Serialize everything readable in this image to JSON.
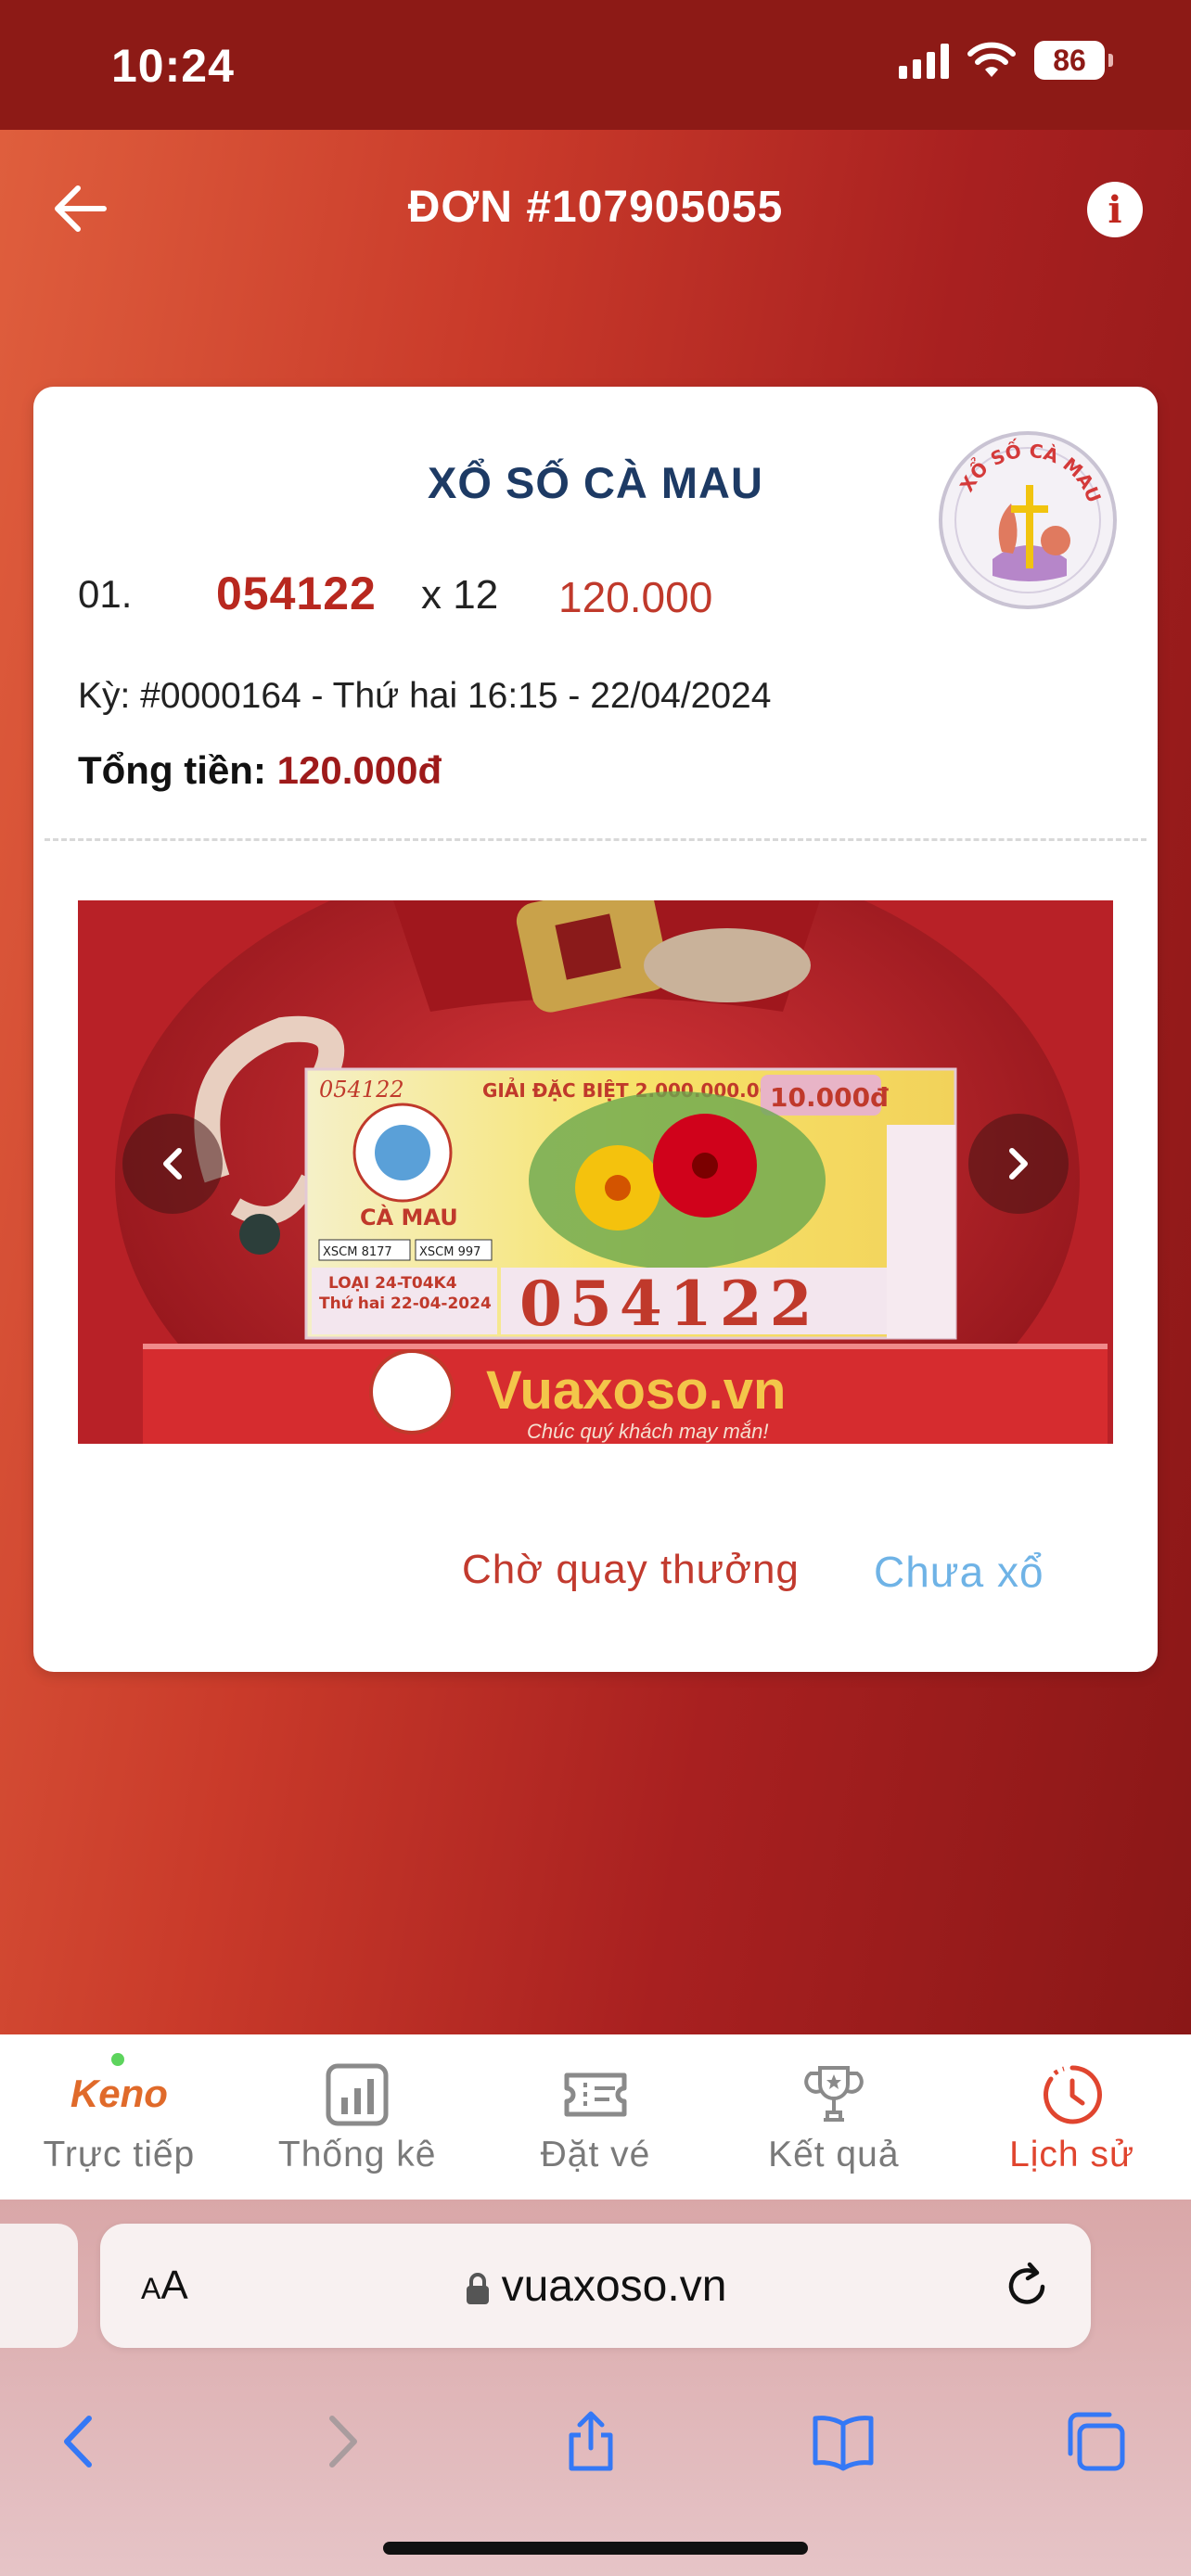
{
  "status_bar": {
    "time": "10:24",
    "battery": "86"
  },
  "header": {
    "title": "ĐƠN #107905055"
  },
  "order": {
    "lottery_name": "XỔ SỐ CÀ MAU",
    "logo_text": "XỔ SỐ CÀ MAU",
    "ticket": {
      "index": "01.",
      "number": "054122",
      "quantity": "x 12",
      "amount": "120.000"
    },
    "draw_info": "Kỳ: #0000164 - Thứ hai 16:15 - 22/04/2024",
    "total_label": "Tổng tiền:",
    "total_value": "120.000đ",
    "ticket_image": {
      "top_serial": "054122",
      "prize_label": "GIẢI ĐẶC BIỆT 2.000.000.000đ",
      "price": "10.000đ",
      "province": "CÀ MAU",
      "series": "LOẠI 24-T04K4",
      "date": "Thứ hai 22-04-2024",
      "big_number": "054122",
      "code_left": "XSCM 8177",
      "code_right": "XSCM 997",
      "banner": "Vuaxoso.vn",
      "slogan": "Chúc quý khách may mắn!"
    },
    "status_waiting": "Chờ quay thưởng",
    "status_result": "Chưa xổ"
  },
  "tabs": [
    {
      "logo": "Keno",
      "label": "Trực tiếp",
      "icon": "keno-logo"
    },
    {
      "label": "Thống kê",
      "icon": "chart-icon"
    },
    {
      "label": "Đặt vé",
      "icon": "ticket-icon"
    },
    {
      "label": "Kết quả",
      "icon": "trophy-icon"
    },
    {
      "label": "Lịch sử",
      "icon": "clock-icon",
      "active": true
    }
  ],
  "browser": {
    "aa": "AA",
    "url": "vuaxoso.vn"
  },
  "colors": {
    "primary_red": "#b8281f",
    "brand_dark_red": "#8d1a16",
    "navy": "#1d3a64",
    "sky": "#6fb3e6"
  }
}
